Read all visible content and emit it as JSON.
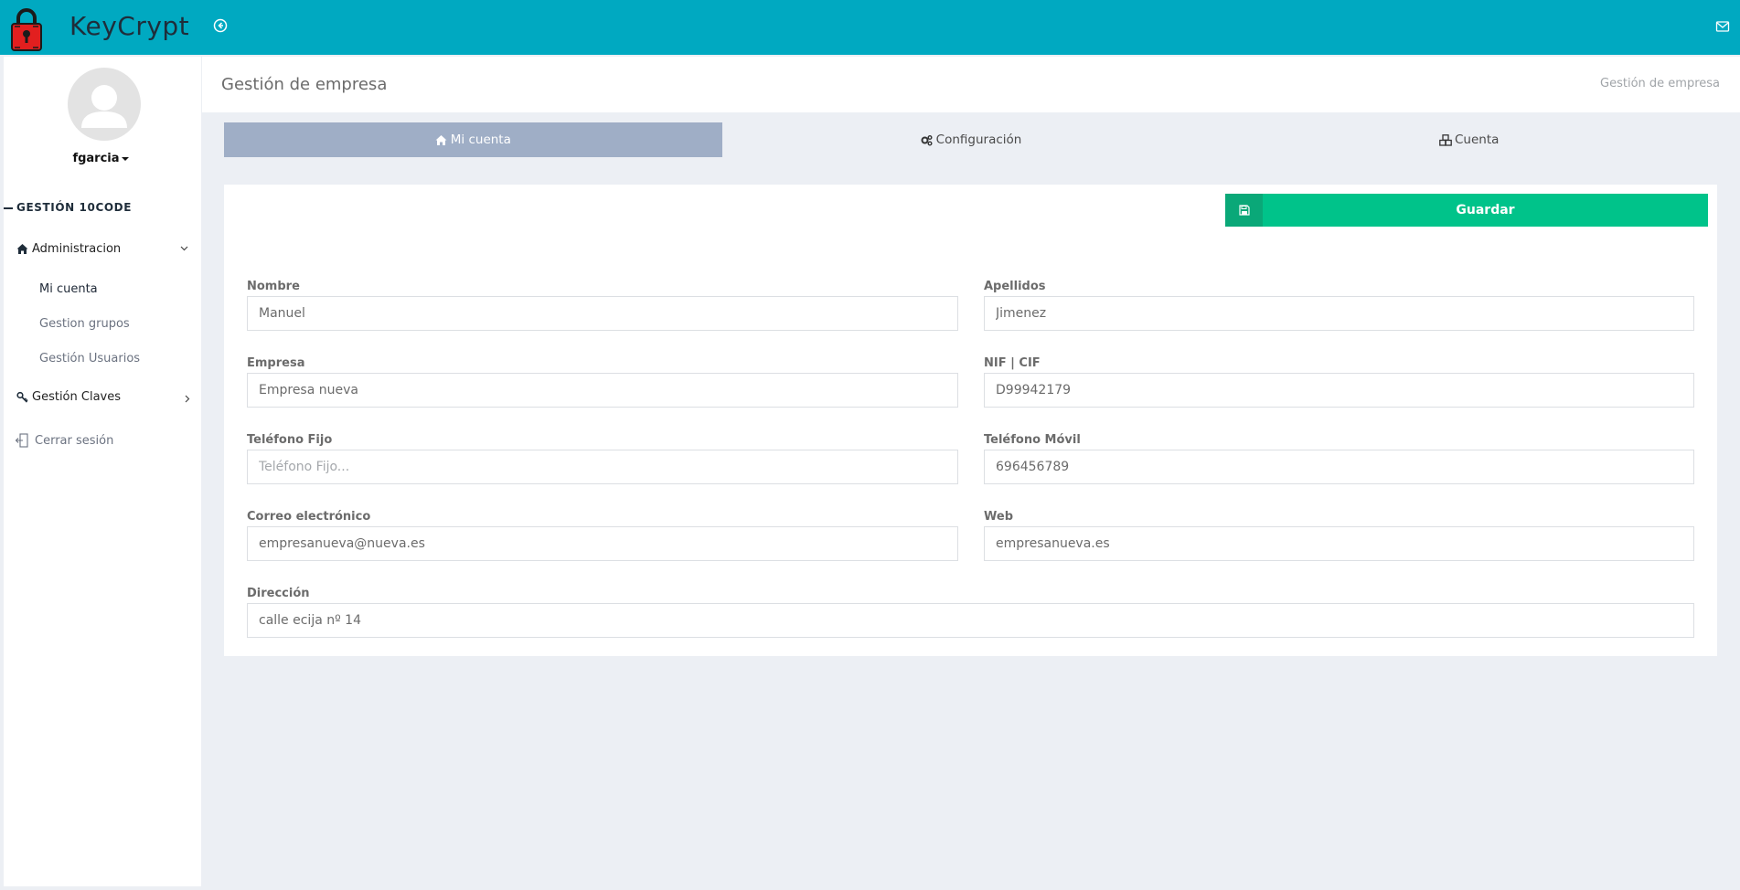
{
  "app": {
    "name": "KeyCrypt"
  },
  "colors": {
    "topbar": "#00a9c1",
    "accent_green": "#00c38a",
    "active_tab": "#9faec6"
  },
  "icons": {
    "logo": "red-padlock-logo",
    "collapse": "circle-arrow-left-icon",
    "mail": "envelope-icon"
  },
  "sidebar": {
    "username": "fgarcia",
    "section_title": "GESTIÓN 10CODE",
    "groups": [
      {
        "label": "Administracion",
        "icon": "home-icon",
        "expanded": true,
        "items": [
          {
            "label": "Mi cuenta",
            "active": true
          },
          {
            "label": "Gestion grupos"
          },
          {
            "label": "Gestión Usuarios"
          }
        ]
      },
      {
        "label": "Gestión Claves",
        "icon": "key-icon",
        "expanded": false,
        "items": []
      }
    ],
    "logout_label": "Cerrar sesión"
  },
  "header": {
    "title": "Gestión de empresa",
    "breadcrumb": "Gestión de empresa"
  },
  "tabs": [
    {
      "label": "Mi cuenta",
      "icon": "home-icon",
      "active": true
    },
    {
      "label": "Configuración",
      "icon": "gears-icon",
      "active": false
    },
    {
      "label": "Cuenta",
      "icon": "cubes-icon",
      "active": false
    }
  ],
  "form": {
    "save_label": "Guardar",
    "fields": {
      "nombre": {
        "label": "Nombre",
        "value": "Manuel",
        "placeholder": ""
      },
      "apellidos": {
        "label": "Apellidos",
        "value": "Jimenez",
        "placeholder": ""
      },
      "empresa": {
        "label": "Empresa",
        "value": "Empresa nueva",
        "placeholder": ""
      },
      "nif": {
        "label": "NIF | CIF",
        "value": "D99942179",
        "placeholder": ""
      },
      "telefono_fijo": {
        "label": "Teléfono Fijo",
        "value": "",
        "placeholder": "Teléfono Fijo..."
      },
      "telefono_movil": {
        "label": "Teléfono Móvil",
        "value": "696456789",
        "placeholder": ""
      },
      "correo": {
        "label": "Correo electrónico",
        "value": "empresanueva@nueva.es",
        "placeholder": ""
      },
      "web": {
        "label": "Web",
        "value": "empresanueva.es",
        "placeholder": ""
      },
      "direccion": {
        "label": "Dirección",
        "value": "calle ecija nº 14",
        "placeholder": ""
      }
    }
  }
}
